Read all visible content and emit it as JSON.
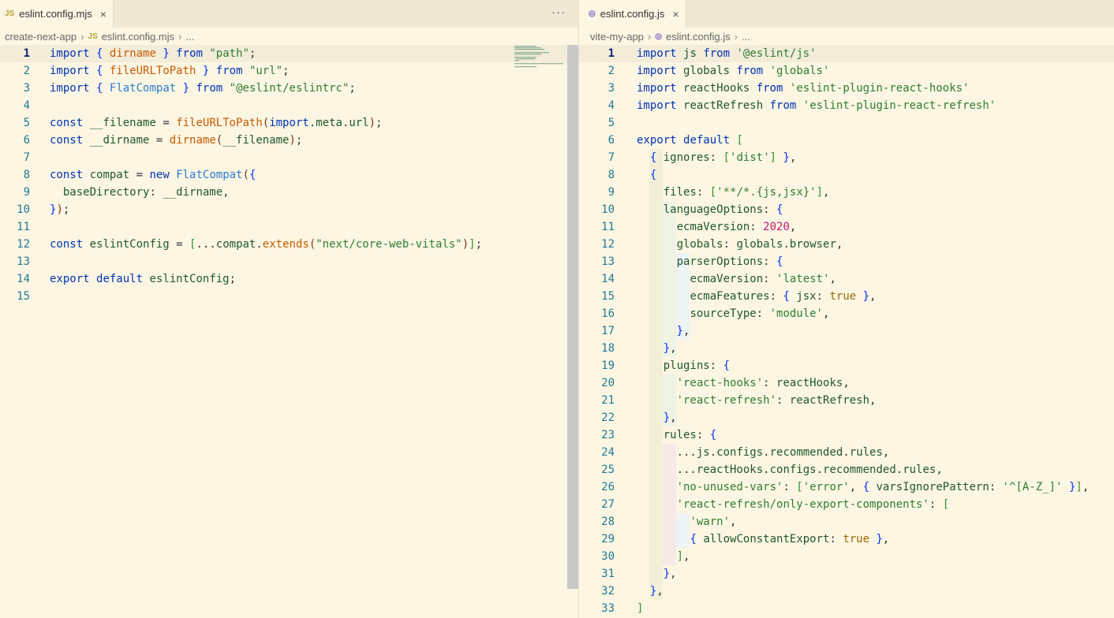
{
  "left": {
    "tab": {
      "icon": "JS",
      "title": "eslint.config.mjs",
      "close": "×"
    },
    "more": "···",
    "breadcrumb": [
      "create-next-app",
      "JS",
      "eslint.config.mjs",
      "..."
    ],
    "lines": [
      "import { dirname } from \"path\";",
      "import { fileURLToPath } from \"url\";",
      "import { FlatCompat } from \"@eslint/eslintrc\";",
      "",
      "const __filename = fileURLToPath(import.meta.url);",
      "const __dirname = dirname(__filename);",
      "",
      "const compat = new FlatCompat({",
      "  baseDirectory: __dirname,",
      "});",
      "",
      "const eslintConfig = [...compat.extends(\"next/core-web-vitals\")];",
      "",
      "export default eslintConfig;",
      ""
    ]
  },
  "right": {
    "tab": {
      "title": "eslint.config.js",
      "close": "×"
    },
    "breadcrumb": [
      "vite-my-app",
      "eslint.config.js",
      "..."
    ],
    "lines": [
      "import js from '@eslint/js'",
      "import globals from 'globals'",
      "import reactHooks from 'eslint-plugin-react-hooks'",
      "import reactRefresh from 'eslint-plugin-react-refresh'",
      "",
      "export default [",
      "  { ignores: ['dist'] },",
      "  {",
      "    files: ['**/*.{js,jsx}'],",
      "    languageOptions: {",
      "      ecmaVersion: 2020,",
      "      globals: globals.browser,",
      "      parserOptions: {",
      "        ecmaVersion: 'latest',",
      "        ecmaFeatures: { jsx: true },",
      "        sourceType: 'module',",
      "      },",
      "    },",
      "    plugins: {",
      "      'react-hooks': reactHooks,",
      "      'react-refresh': reactRefresh,",
      "    },",
      "    rules: {",
      "      ...js.configs.recommended.rules,",
      "      ...reactHooks.configs.recommended.rules,",
      "      'no-unused-vars': ['error', { varsIgnorePattern: '^[A-Z_]' }],",
      "      'react-refresh/only-export-components': [",
      "        'warn',",
      "        { allowConstantExport: true },",
      "      ],",
      "    },",
      "  },",
      "]"
    ]
  }
}
